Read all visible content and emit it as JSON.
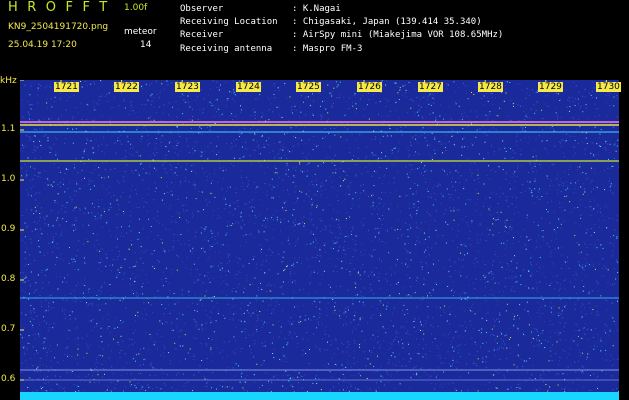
{
  "header": {
    "app_title": "HROFFT",
    "version": "1.00f",
    "filename": "KN9_2504191720.png",
    "meteor_label": "meteor",
    "timestamp": "25.04.19 17:20",
    "meteor_count": "14",
    "info": [
      {
        "key": "Observer",
        "value": ": K.Nagai"
      },
      {
        "key": "Receiving Location",
        "value": ": Chigasaki, Japan (139.414 35.340)"
      },
      {
        "key": "Receiver",
        "value": ": AirSpy mini (Miakejima VOR 108.65MHz)"
      },
      {
        "key": "Receiving antenna",
        "value": ": Maspro FM-3"
      }
    ]
  },
  "axis": {
    "unit": "kHz",
    "y_ticks": [
      "1.1",
      "1.0",
      "0.9",
      "0.8",
      "0.7",
      "0.6"
    ],
    "x_ticks": [
      "1721",
      "1722",
      "1723",
      "1724",
      "1725",
      "1726",
      "1727",
      "1728",
      "1729",
      "1730"
    ]
  },
  "colors": {
    "background": "#1b2a9a",
    "axis_label": "#f5e94a",
    "app_title": "#c8e62a",
    "noise_cyan": "#3fd6ff",
    "noise_yellow": "#e6e04a",
    "floor": "#19d6ff"
  }
}
